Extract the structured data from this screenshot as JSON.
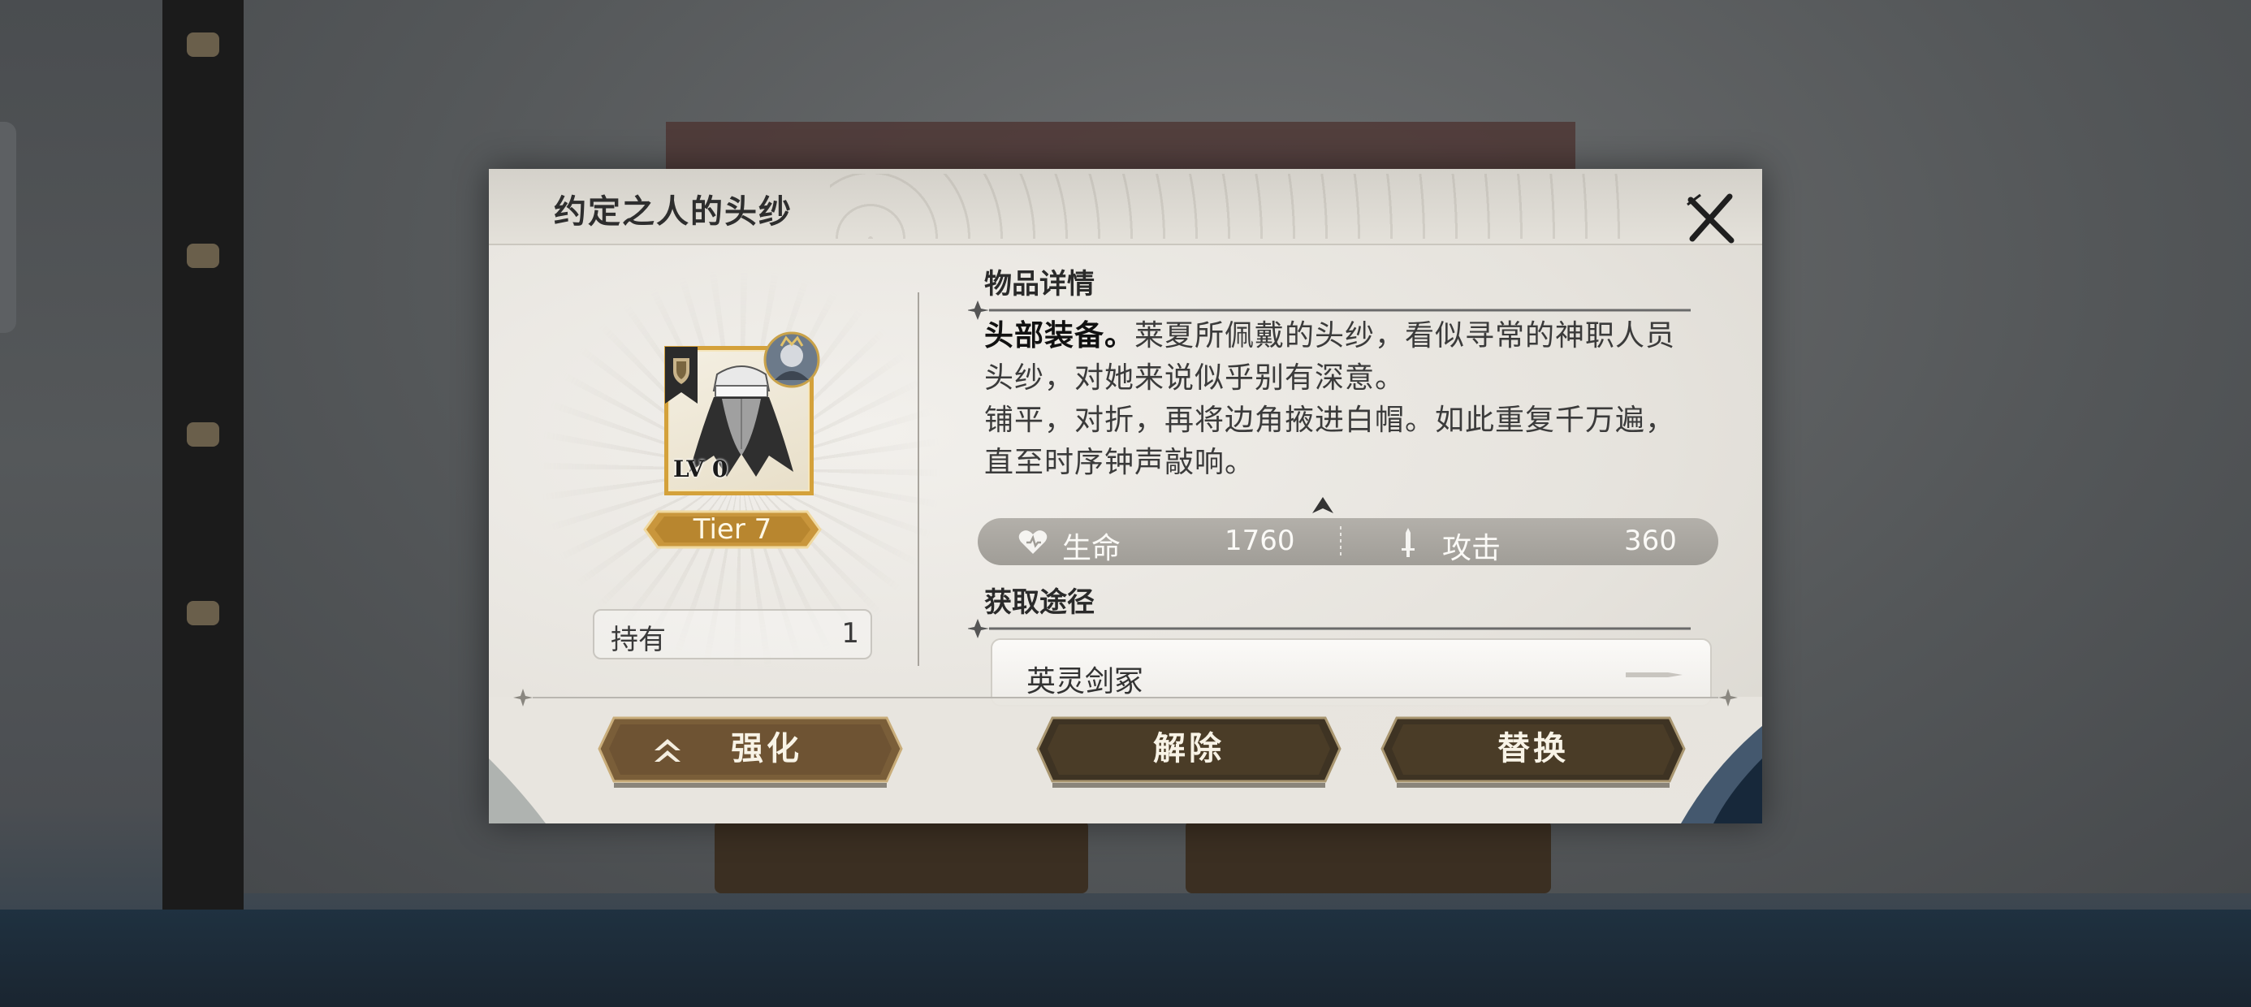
{
  "dialog": {
    "title": "约定之人的头纱",
    "close_icon": "close-x-icon"
  },
  "item": {
    "level": "LV 0",
    "tier": "Tier 7",
    "owned_label": "持有",
    "owned_count": "1",
    "banner_icon": "shield-banner-icon",
    "portrait_icon": "character-portrait-icon",
    "image": "veil-headpiece-image"
  },
  "details": {
    "heading": "物品详情",
    "lead": "头部装备。",
    "text1": "莱夏所佩戴的头纱，看似寻常的神职人员头纱，对她来说似乎别有深意。",
    "text2": "铺平，对折，再将边角掖进白帽。如此重复千万遍，直至时序钟声敲响。"
  },
  "stats": [
    {
      "icon": "heart-icon",
      "label": "生命",
      "value": "1760"
    },
    {
      "icon": "sword-icon",
      "label": "攻击",
      "value": "360"
    }
  ],
  "sources": {
    "heading": "获取途径",
    "items": [
      {
        "label": "英灵剑冢"
      }
    ]
  },
  "buttons": {
    "upgrade": "强化",
    "unequip": "解除",
    "replace": "替换"
  },
  "colors": {
    "gold": "#d4a13a",
    "button_dark": "#3d3322",
    "button_bronze": "#6e5535",
    "stat_bar": "#a9a6a0"
  }
}
